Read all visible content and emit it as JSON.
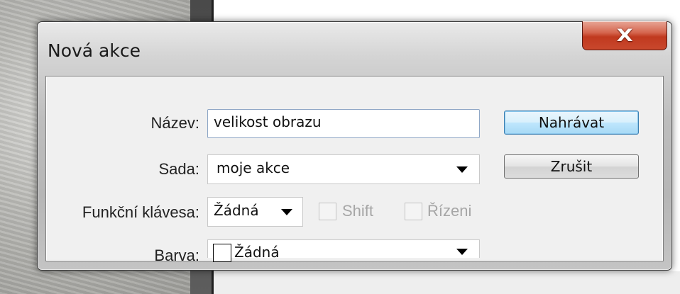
{
  "dialog": {
    "title": "Nová akce",
    "close_glyph": "X"
  },
  "form": {
    "name": {
      "label": "Název:",
      "value": "velikost obrazu"
    },
    "set": {
      "label": "Sada:",
      "value": "moje akce"
    },
    "function_key": {
      "label": "Funkční klávesa:",
      "value": "Žádná",
      "shift_label": "Shift",
      "shift_checked": false,
      "control_label": "Řízeni",
      "control_checked": false
    },
    "color": {
      "label": "Barva:",
      "value": "Žádná",
      "swatch_color": "#ffffff"
    }
  },
  "buttons": {
    "record_label": "Nahrávat",
    "cancel_label": "Zrušit"
  },
  "icons": {
    "close": "close-icon",
    "dropdown": "chevron-down-icon"
  }
}
